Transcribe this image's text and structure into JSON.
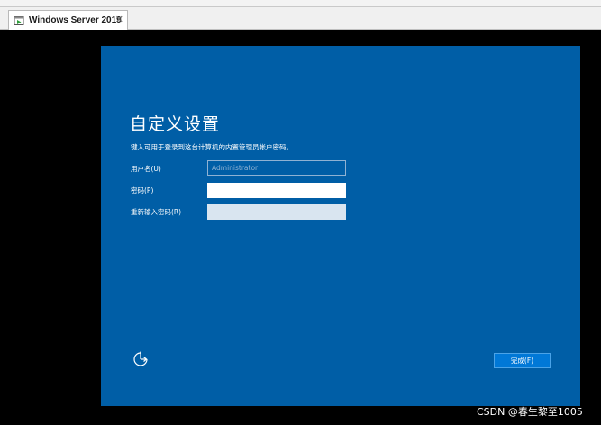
{
  "window": {
    "tab_title": "Windows Server 2019",
    "close_glyph": "✕",
    "tab_icon": "vm-running-icon"
  },
  "setup": {
    "heading": "自定义设置",
    "instruction": "键入可用于登录到这台计算机的内置管理员帐户密码。",
    "username_label": "用户名(U)",
    "username_placeholder": "Administrator",
    "username_value": "",
    "password_label": "密码(P)",
    "password_value": "",
    "reenter_label": "重新输入密码(R)",
    "reenter_value": "",
    "finish_label": "完成(F)",
    "accessibility_icon": "ease-of-access-icon"
  },
  "watermark": {
    "text": "CSDN @春生黎至1005"
  },
  "colors": {
    "panel_blue": "#005ea6",
    "vm_background": "#000000",
    "button_blue": "#0078d7"
  }
}
